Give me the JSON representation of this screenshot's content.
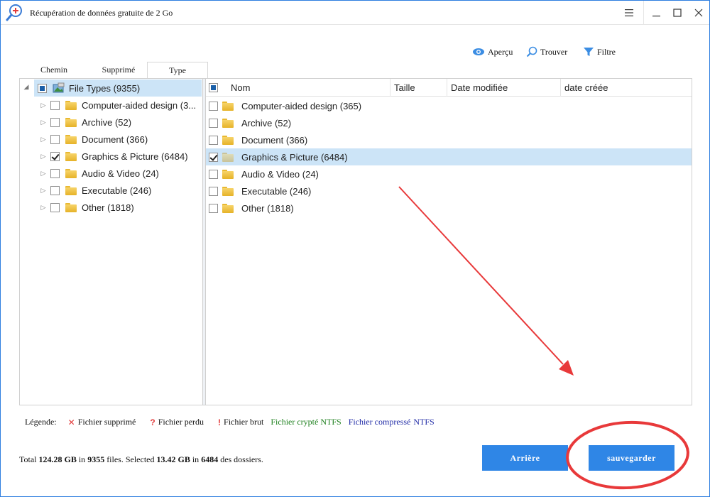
{
  "window": {
    "title": "Récupération de données gratuite de 2 Go",
    "controls": {
      "menu": "☰",
      "minimize": "—",
      "maximize": "☐",
      "close": "✕"
    }
  },
  "toolbar": {
    "preview_label": "Aperçu",
    "find_label": "Trouver",
    "filter_label": "Filtre"
  },
  "tabs": [
    {
      "label": "Chemin",
      "active": false
    },
    {
      "label": "Supprimé",
      "active": false
    },
    {
      "label": "Type",
      "active": true
    }
  ],
  "tree": {
    "root": {
      "label": "File Types (9355)"
    },
    "items": [
      {
        "label": "Computer-aided design (3...",
        "checked": false
      },
      {
        "label": "Archive (52)",
        "checked": false
      },
      {
        "label": "Document (366)",
        "checked": false
      },
      {
        "label": "Graphics & Picture (6484)",
        "checked": true
      },
      {
        "label": "Audio & Video (24)",
        "checked": false
      },
      {
        "label": "Executable (246)",
        "checked": false
      },
      {
        "label": "Other (1818)",
        "checked": false
      }
    ]
  },
  "list": {
    "columns": {
      "name": "Nom",
      "size": "Taille",
      "modified": "Date modifiée",
      "created": "date créée"
    },
    "rows": [
      {
        "name": "Computer-aided design (365)",
        "checked": false
      },
      {
        "name": "Archive (52)",
        "checked": false
      },
      {
        "name": "Document (366)",
        "checked": false
      },
      {
        "name": "Graphics & Picture (6484)",
        "checked": true
      },
      {
        "name": "Audio & Video (24)",
        "checked": false
      },
      {
        "name": "Executable (246)",
        "checked": false
      },
      {
        "name": "Other (1818)",
        "checked": false
      }
    ]
  },
  "legend": {
    "title": "Légende:",
    "deleted_symbol": "✕",
    "deleted": "Fichier supprimé",
    "lost_symbol": "?",
    "lost": "Fichier perdu",
    "raw_symbol": "!",
    "raw": "Fichier brut",
    "encrypted": "Fichier crypté NTFS",
    "compressed_label": "Fichier compressé",
    "compressed_suffix": "NTFS"
  },
  "status": {
    "prefix": "Total",
    "total_size": "124.28 GB",
    "in1": "in",
    "total_files": "9355",
    "files_selected": "files. Selected",
    "selected_size": "13.42 GB",
    "in2": "in",
    "selected_count": "6484",
    "suffix": "des dossiers."
  },
  "buttons": {
    "back": "Arrière",
    "save": "sauvegarder"
  },
  "colors": {
    "accent": "#2f86e6",
    "selection": "#cce4f7",
    "annotation": "#e8393a"
  }
}
